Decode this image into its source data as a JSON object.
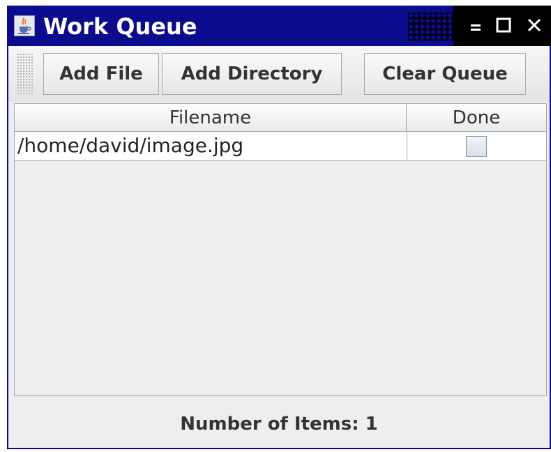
{
  "window": {
    "title": "Work Queue",
    "icon": "java-cup-icon",
    "controls": [
      "minimize-icon",
      "maximize-icon",
      "close-icon"
    ]
  },
  "toolbar": {
    "add_file_label": "Add File",
    "add_directory_label": "Add Directory",
    "clear_queue_label": "Clear Queue"
  },
  "table": {
    "columns": [
      "Filename",
      "Done"
    ],
    "rows": [
      {
        "filename": "/home/david/image.jpg",
        "done": false
      }
    ]
  },
  "status": {
    "text": "Number of Items: 1"
  },
  "colors": {
    "titlebar": "#0b0b8e",
    "background": "#eeeeee",
    "grid": "#9ea8b8"
  }
}
